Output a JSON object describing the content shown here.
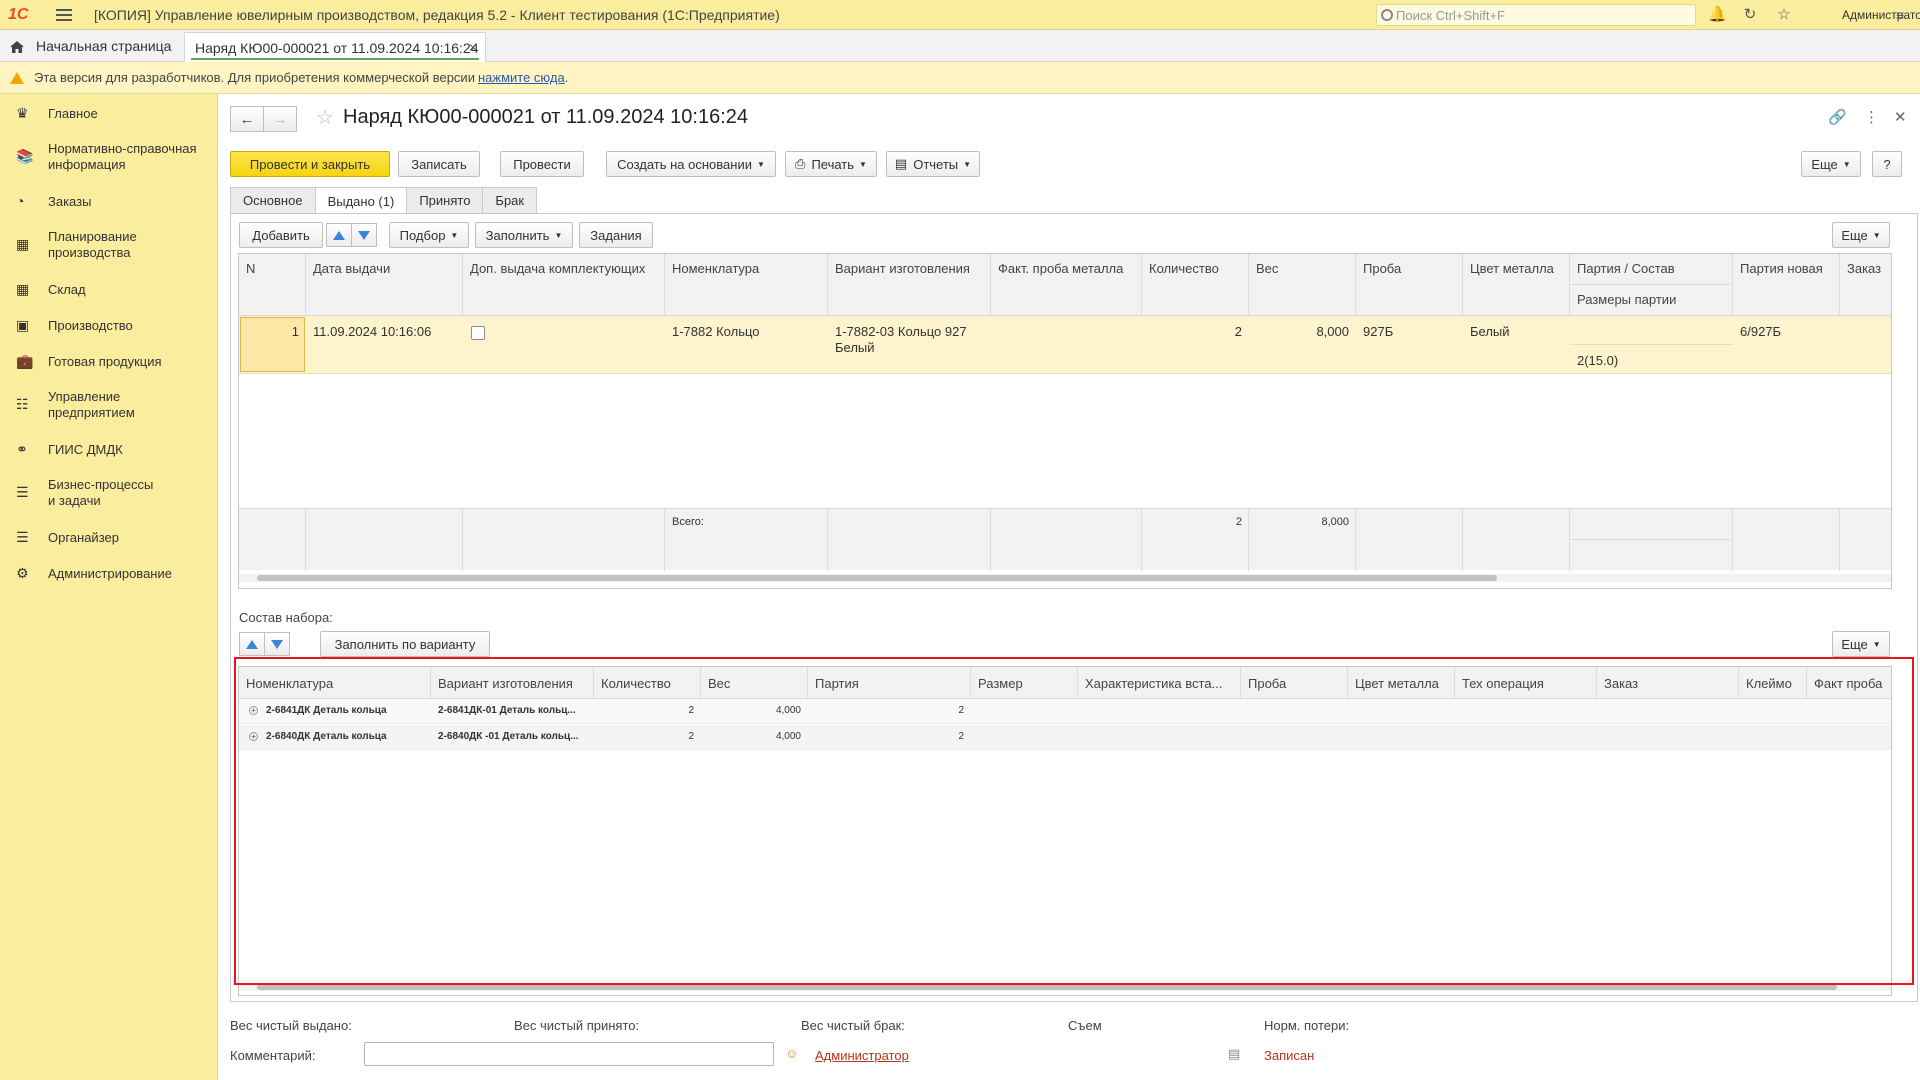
{
  "app": {
    "title": "[КОПИЯ] Управление ювелирным производством, редакция 5.2  - Клиент тестирования (1С:Предприятие)",
    "search_placeholder": "Поиск Ctrl+Shift+F",
    "user": "Администратор",
    "logo": "1С"
  },
  "tabs": {
    "home": "Начальная страница",
    "doc": "Наряд КЮ00-000021 от 11.09.2024 10:16:24"
  },
  "banner": {
    "text": "Эта версия для разработчиков. Для приобретения коммерческой версии",
    "link": "нажмите сюда",
    "suffix": "."
  },
  "sidebar": {
    "items": [
      {
        "label": "Главное",
        "icon": "crown-icon"
      },
      {
        "label": "Нормативно-справочная\nинформация",
        "icon": "books-icon"
      },
      {
        "label": "Заказы",
        "icon": "pie-icon"
      },
      {
        "label": "Планирование\nпроизводства",
        "icon": "calculator-icon"
      },
      {
        "label": "Склад",
        "icon": "grid-icon"
      },
      {
        "label": "Производство",
        "icon": "factory-icon"
      },
      {
        "label": "Готовая продукция",
        "icon": "bag-icon"
      },
      {
        "label": "Управление\nпредприятием",
        "icon": "chart-icon"
      },
      {
        "label": "ГИИС ДМДК",
        "icon": "ring-icon"
      },
      {
        "label": "Бизнес-процессы\nи задачи",
        "icon": "list-icon"
      },
      {
        "label": "Органайзер",
        "icon": "organizer-icon"
      },
      {
        "label": "Администрирование",
        "icon": "gear-icon"
      }
    ]
  },
  "form": {
    "title": "Наряд КЮ00-000021 от 11.09.2024 10:16:24",
    "toolbar": {
      "post_close": "Провести и закрыть",
      "save": "Записать",
      "post": "Провести",
      "create_based": "Создать на основании",
      "print": "Печать",
      "reports": "Отчеты",
      "more": "Еще",
      "help": "?"
    },
    "tabs": [
      "Основное",
      "Выдано (1)",
      "Принято",
      "Брак"
    ],
    "issued": {
      "toolbar": {
        "add": "Добавить",
        "select": "Подбор",
        "fill": "Заполнить",
        "tasks": "Задания",
        "more": "Еще"
      },
      "columns": [
        "N",
        "Дата выдачи",
        "Доп. выдача комплектующих",
        "Номенклатура",
        "Вариант изготовления",
        "Факт. проба металла",
        "Количество",
        "Вес",
        "Проба",
        "Цвет металла",
        "Партия / Состав",
        "Партия новая",
        "Заказ"
      ],
      "subcolumn": "Размеры партии",
      "rows": [
        {
          "n": "1",
          "date": "11.09.2024 10:16:06",
          "nomenclature": "1-7882 Кольцо",
          "variant": "1-7882-03 Кольцо 927 Белый",
          "qty": "2",
          "weight": "8,000",
          "probe": "927Б",
          "color": "Белый",
          "batch": "",
          "batch_sizes": "2(15.0)",
          "batch_new": "6/927Б",
          "order": ""
        }
      ],
      "totals": {
        "label": "Всего:",
        "qty": "2",
        "weight": "8,000"
      }
    },
    "kit": {
      "label": "Состав набора:",
      "fill_by_variant": "Заполнить по варианту",
      "more": "Еще",
      "columns": [
        "Номенклатура",
        "Вариант изготовления",
        "Количество",
        "Вес",
        "Партия",
        "Размер",
        "Характеристика вста...",
        "Проба",
        "Цвет металла",
        "Тех операция",
        "Заказ",
        "Клеймо",
        "Факт проба"
      ],
      "rows": [
        {
          "nomenclature": "2-6841ДК Деталь кольца",
          "variant": "2-6841ДК-01 Деталь кольц...",
          "qty": "2",
          "weight": "4,000",
          "batch": "2"
        },
        {
          "nomenclature": "2-6840ДК Деталь кольца",
          "variant": "2-6840ДК -01 Деталь кольц...",
          "qty": "2",
          "weight": "4,000",
          "batch": "2"
        }
      ]
    },
    "footer": {
      "net_issued": "Вес чистый выдано:",
      "net_accepted": "Вес чистый принято:",
      "net_defect": "Вес чистый брак:",
      "removal": "Съем",
      "norm_loss": "Норм. потери:",
      "comment_label": "Комментарий:",
      "comment_value": "",
      "author": "Администратор",
      "status": "Записан"
    }
  },
  "colors": {
    "sidebar_bg": "#fbed9e",
    "primary_btn": "#f6d411",
    "highlight": "#e8131f",
    "link": "#b5361d",
    "row_selected": "#fdf3cc"
  }
}
